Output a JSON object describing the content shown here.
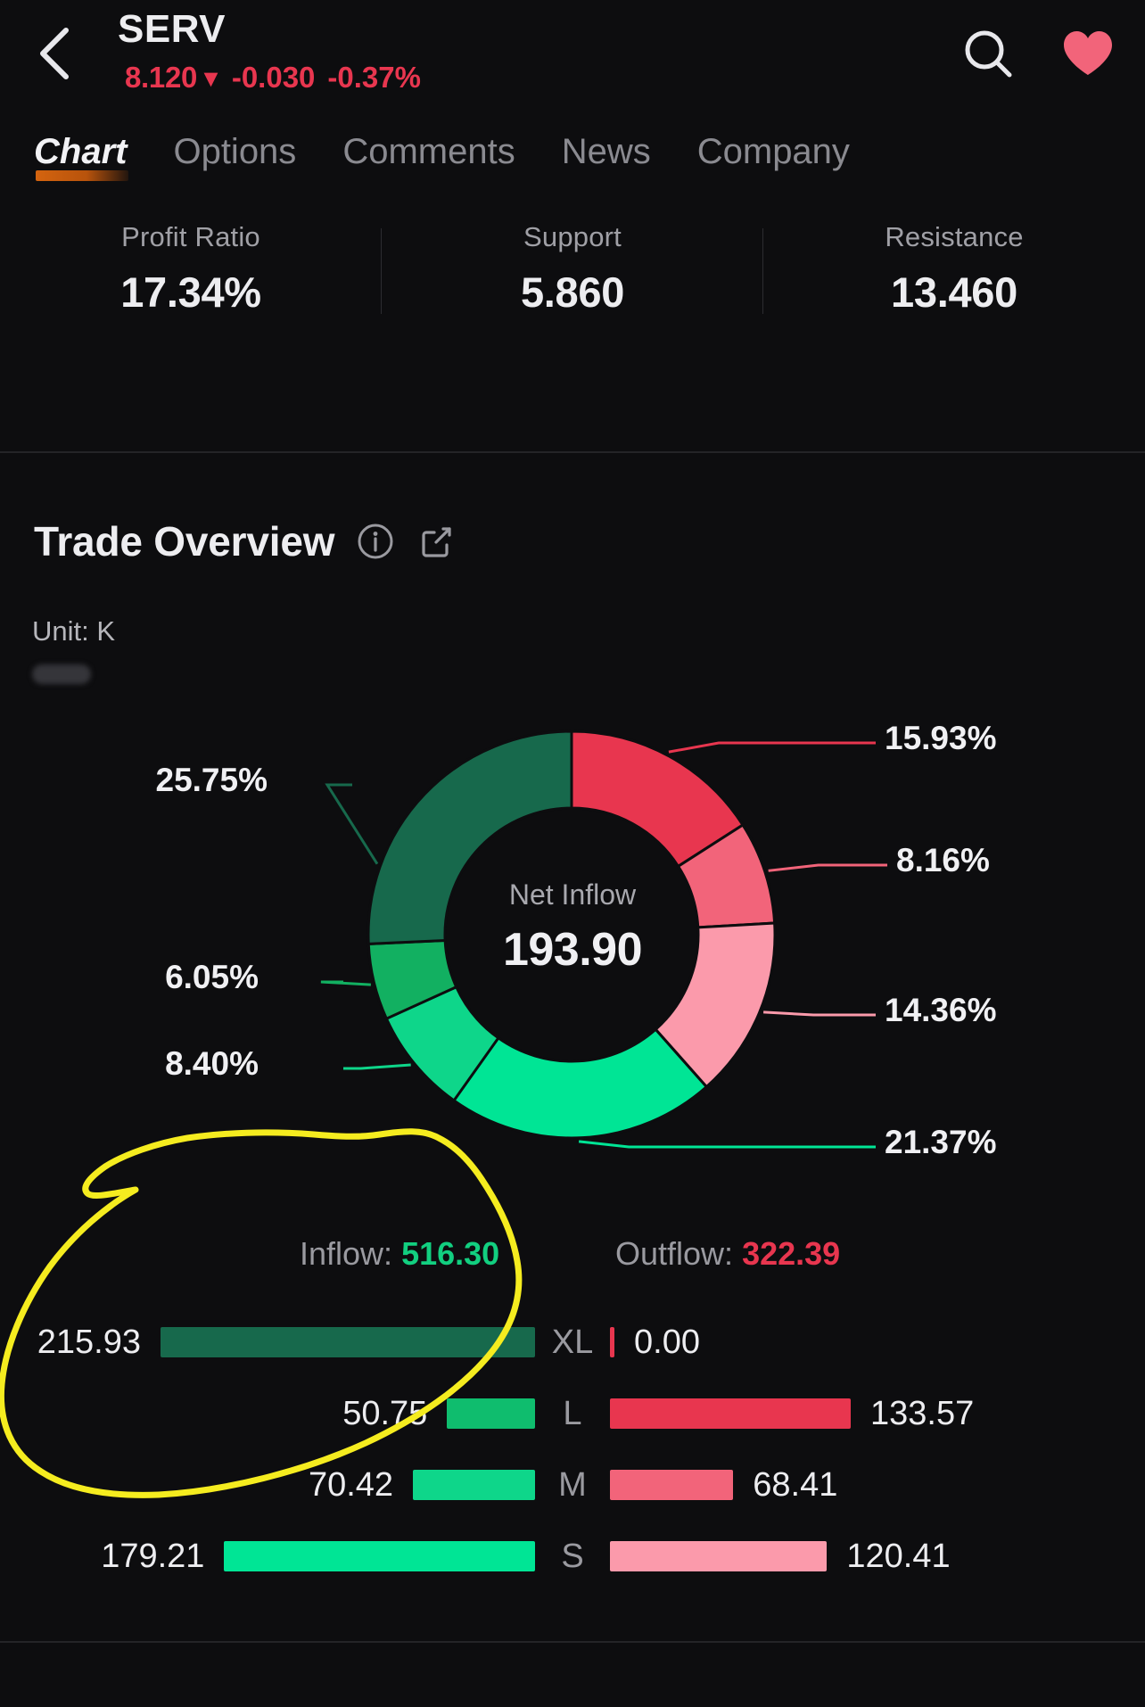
{
  "header": {
    "back_icon": "chevron-left-icon",
    "ticker": "SERV",
    "price": "8.120",
    "direction_arrow": "▼",
    "change": "-0.030",
    "change_percent": "-0.37%",
    "search_icon": "search-icon",
    "favorite_icon": "heart-icon",
    "down_color": "#e8364f",
    "favorite_color": "#f2647a"
  },
  "tabs": [
    {
      "label": "Chart",
      "active": true
    },
    {
      "label": "Options",
      "active": false
    },
    {
      "label": "Comments",
      "active": false
    },
    {
      "label": "News",
      "active": false
    },
    {
      "label": "Company",
      "active": false
    }
  ],
  "stats": [
    {
      "label": "Profit Ratio",
      "value": "17.34%"
    },
    {
      "label": "Support",
      "value": "5.860"
    },
    {
      "label": "Resistance",
      "value": "13.460"
    }
  ],
  "trade_overview": {
    "title": "Trade Overview",
    "info_icon": "info-circle-icon",
    "share_icon": "share-export-icon",
    "unit_label": "Unit: K",
    "center_title": "Net Inflow",
    "center_value": "193.90",
    "inflow_label": "Inflow:",
    "inflow_value": "516.30",
    "outflow_label": "Outflow:",
    "outflow_value": "322.39"
  },
  "chart_data": {
    "type": "pie",
    "title": "Trade Overview",
    "subtitle": "Unit: K",
    "center_label": "Net Inflow",
    "center_value": 193.9,
    "legend": "none",
    "slices": [
      {
        "name": "Outflow XL",
        "percent": 15.93,
        "label": "15.93%",
        "color": "#e8364f",
        "start_deg": 0,
        "end_deg": 57.35
      },
      {
        "name": "Outflow L",
        "percent": 8.16,
        "label": "8.16%",
        "color": "#f2647a",
        "start_deg": 57.35,
        "end_deg": 86.73
      },
      {
        "name": "Outflow M",
        "percent": 14.36,
        "label": "14.36%",
        "color": "#fb9aab",
        "start_deg": 86.73,
        "end_deg": 138.43
      },
      {
        "name": "Inflow S",
        "percent": 21.37,
        "label": "21.37%",
        "color": "#00e595",
        "start_deg": 138.43,
        "end_deg": 215.36
      },
      {
        "name": "Inflow M",
        "percent": 8.4,
        "label": "8.40%",
        "color": "#0ed68a",
        "start_deg": 215.36,
        "end_deg": 245.6
      },
      {
        "name": "Inflow L",
        "percent": 6.05,
        "label": "6.05%",
        "color": "#12b061",
        "start_deg": 245.6,
        "end_deg": 267.38
      },
      {
        "name": "Inflow XL",
        "percent": 25.75,
        "label": "25.75%",
        "color": "#17694c",
        "start_deg": 267.38,
        "end_deg": 360
      }
    ],
    "bars": {
      "type": "bar",
      "orientation": "horizontal-diverging",
      "categories": [
        "XL",
        "L",
        "M",
        "S"
      ],
      "series": [
        {
          "name": "Inflow",
          "values": [
            215.93,
            50.75,
            70.42,
            179.21
          ],
          "labels": [
            "215.93",
            "50.75",
            "70.42",
            "179.21"
          ],
          "colors": [
            "#17694c",
            "#0fbd6e",
            "#0ed68a",
            "#00e595"
          ]
        },
        {
          "name": "Outflow",
          "values": [
            0.0,
            133.57,
            68.41,
            120.41
          ],
          "labels": [
            "0.00",
            "133.57",
            "68.41",
            "120.41"
          ],
          "colors": [
            "#e8364f",
            "#e8364f",
            "#f2647a",
            "#fb9aab"
          ]
        }
      ],
      "inflow_total": 516.3,
      "outflow_total": 322.39
    }
  },
  "annotation": {
    "type": "hand-drawn-circle",
    "color": "#f5ec1f"
  }
}
